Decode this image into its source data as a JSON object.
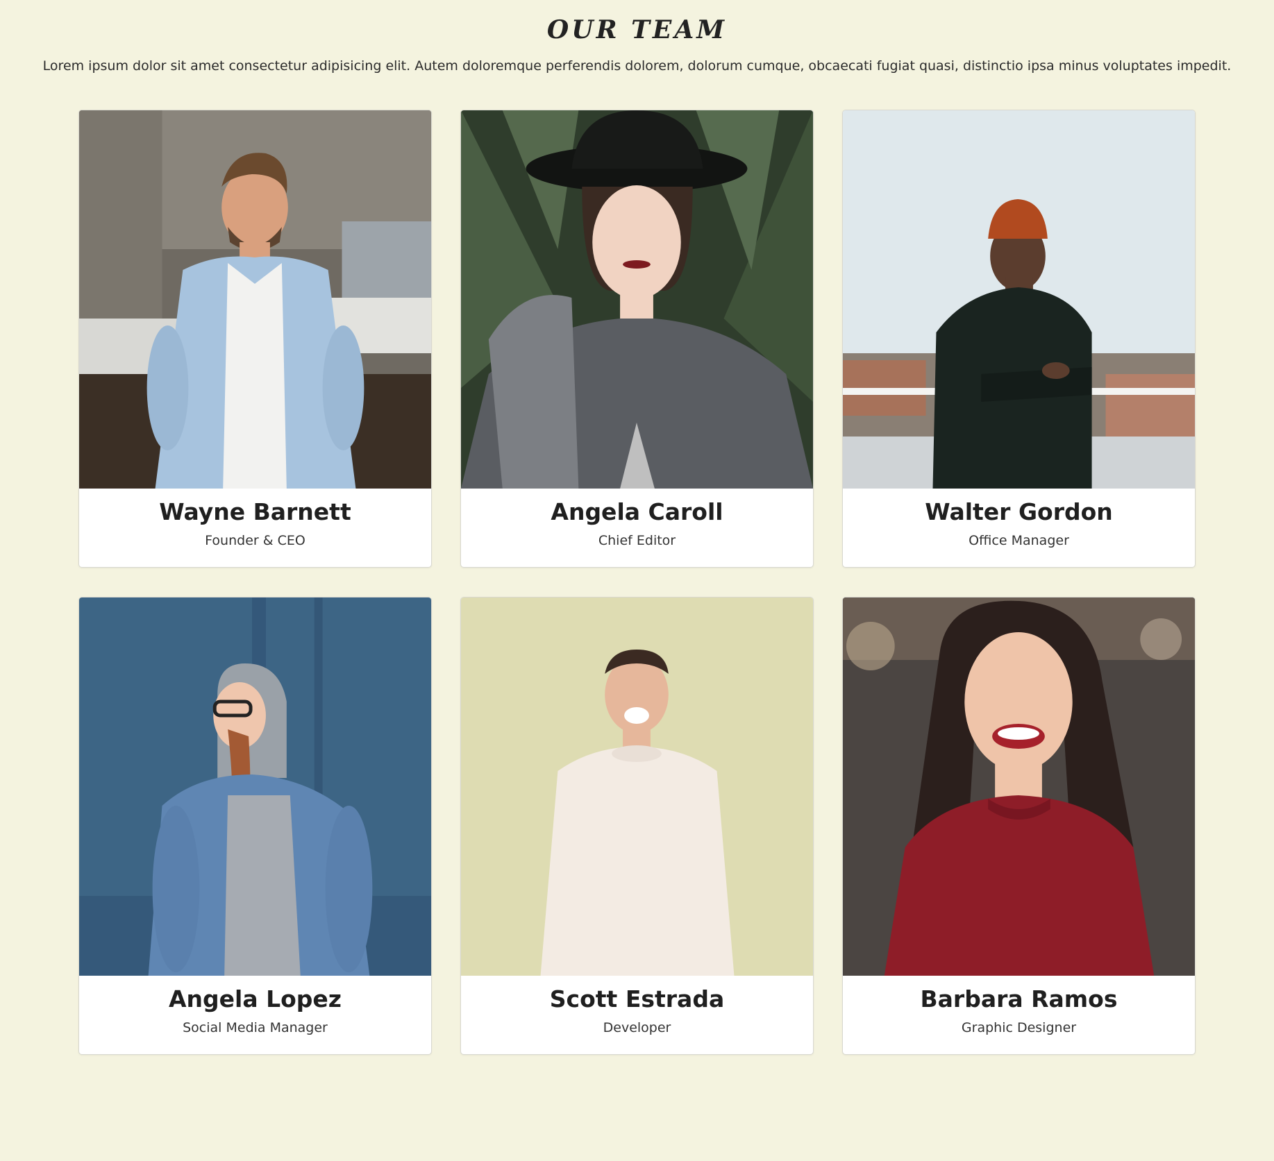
{
  "header": {
    "title": "OUR TEAM",
    "intro": "Lorem ipsum dolor sit amet consectetur adipisicing elit. Autem doloremque perferendis dolorem, dolorum cumque, obcaecati fugiat quasi, distinctio ipsa minus voluptates impedit."
  },
  "team": [
    {
      "name": "Wayne Barnett",
      "role": "Founder & CEO"
    },
    {
      "name": "Angela Caroll",
      "role": "Chief Editor"
    },
    {
      "name": "Walter Gordon",
      "role": "Office Manager"
    },
    {
      "name": "Angela Lopez",
      "role": "Social Media Manager"
    },
    {
      "name": "Scott Estrada",
      "role": "Developer"
    },
    {
      "name": "Barbara Ramos",
      "role": "Graphic Designer"
    }
  ],
  "colors": {
    "page_background": "#f4f3df",
    "card_background": "#ffffff",
    "text": "#1f1f1f"
  }
}
